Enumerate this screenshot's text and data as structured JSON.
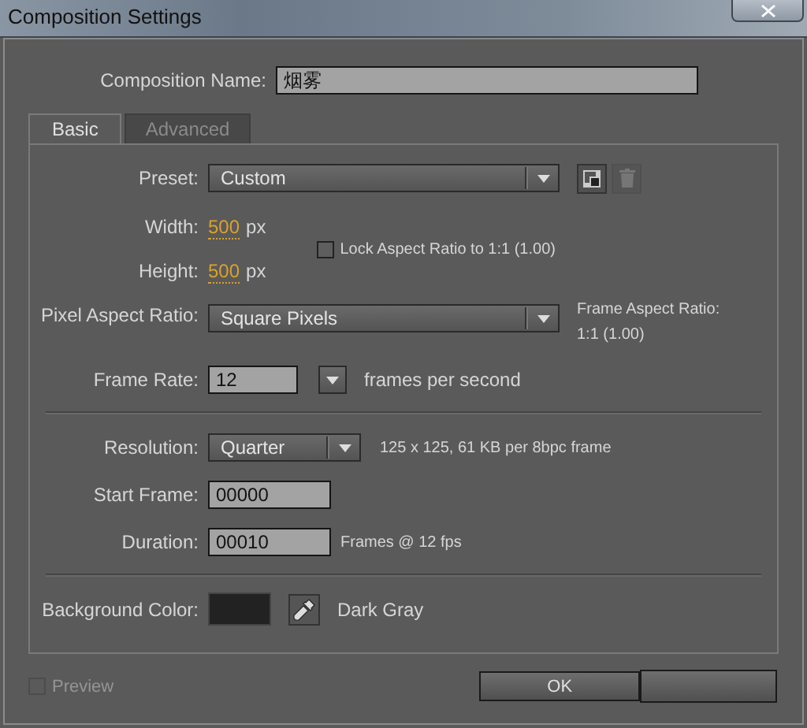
{
  "window": {
    "title": "Composition Settings"
  },
  "composition_name": {
    "label": "Composition Name:",
    "value": "烟雾"
  },
  "tabs": [
    {
      "label": "Basic",
      "selected": true
    },
    {
      "label": "Advanced",
      "selected": false
    }
  ],
  "preset": {
    "label": "Preset:",
    "value": "Custom",
    "delete_disabled": true
  },
  "width": {
    "label": "Width:",
    "value": "500",
    "unit": "px"
  },
  "height": {
    "label": "Height:",
    "value": "500",
    "unit": "px"
  },
  "lock_aspect": {
    "label": "Lock Aspect Ratio to 1:1 (1.00)",
    "checked": false
  },
  "pixel_aspect_ratio": {
    "label": "Pixel Aspect Ratio:",
    "value": "Square Pixels"
  },
  "frame_aspect_ratio": {
    "label": "Frame Aspect Ratio:",
    "value": "1:1 (1.00)"
  },
  "frame_rate": {
    "label": "Frame Rate:",
    "value": "12",
    "unit": "frames per second"
  },
  "resolution": {
    "label": "Resolution:",
    "value": "Quarter",
    "info": "125 x 125, 61 KB per 8bpc frame"
  },
  "start_frame": {
    "label": "Start Frame:",
    "value": "00000"
  },
  "duration": {
    "label": "Duration:",
    "value": "00010",
    "info": "Frames @ 12 fps"
  },
  "background_color": {
    "label": "Background Color:",
    "color": "#222222",
    "name": "Dark Gray"
  },
  "preview": {
    "label": "Preview",
    "checked": false,
    "disabled": true
  },
  "buttons": [
    "OK"
  ]
}
